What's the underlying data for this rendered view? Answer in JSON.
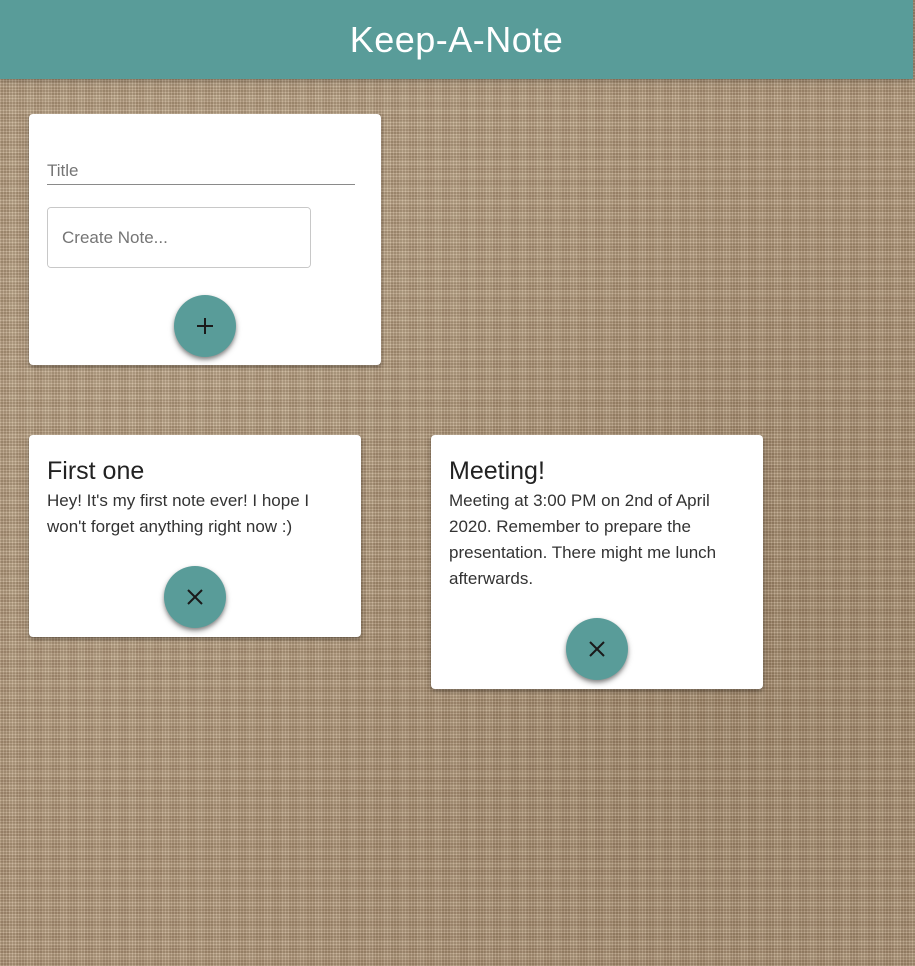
{
  "header": {
    "title": "Keep-A-Note"
  },
  "create_area": {
    "title_placeholder": "Title",
    "title_value": "",
    "content_placeholder": "Create Note...",
    "content_value": "",
    "add_button_icon": "add-icon"
  },
  "notes": [
    {
      "title": "First one",
      "content": "Hey! It's my first note ever! I hope I won't forget anything right now :)",
      "delete_button_icon": "close-icon"
    },
    {
      "title": "Meeting!",
      "content": "Meeting at 3:00 PM on 2nd of April 2020. Remember to prepare the presentation. There might me lunch afterwards.",
      "delete_button_icon": "close-icon"
    }
  ],
  "colors": {
    "accent": "#599c99",
    "header_text": "#ffffff",
    "card_background": "#ffffff"
  }
}
